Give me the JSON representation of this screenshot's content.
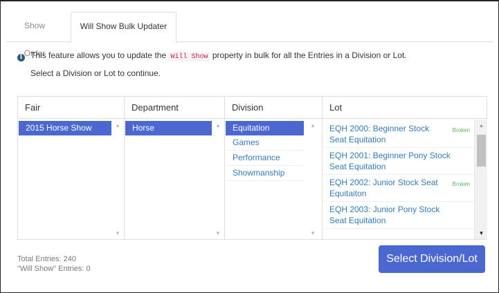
{
  "tabs": [
    {
      "label": "Show Order",
      "active": false
    },
    {
      "label": "Will Show Bulk Updater",
      "active": true
    }
  ],
  "info": {
    "prefix": "This feature allows you to update the",
    "code": "Will Show",
    "suffix": "property in bulk for all the Entries in a Division or Lot.",
    "instruction": "Select a Division or Lot to continue."
  },
  "columns": {
    "fair": {
      "header": "Fair",
      "items": [
        "2015 Horse Show"
      ],
      "selected": 0
    },
    "department": {
      "header": "Department",
      "items": [
        "Horse"
      ],
      "selected": 0
    },
    "division": {
      "header": "Division",
      "items": [
        "Equitation",
        "Games",
        "Performance",
        "Showmanship"
      ],
      "selected": 0
    },
    "lot": {
      "header": "Lot",
      "items": [
        {
          "label": "EQH 2000: Beginner Stock Seat Equitation",
          "badge": "Broken"
        },
        {
          "label": "EQH 2001: Beginner Pony Stock Seat Equitation",
          "badge": ""
        },
        {
          "label": "EQH 2002: Junior Stock Seat Equitaiton",
          "badge": "Broken"
        },
        {
          "label": "EQH 2003: Junior Pony Stock Seat Equitation",
          "badge": ""
        }
      ]
    }
  },
  "footer": {
    "total_entries": "Total Entries: 240",
    "will_show_entries": "\"Will Show\" Entries: 0",
    "button_label": "Select Division/Lot"
  },
  "colors": {
    "accent": "#4a68cf",
    "link": "#337ab7",
    "badge": "#5cb85c",
    "code": "#c7254e"
  },
  "icons": {
    "info": "info-circle-icon",
    "scroll_up": "caret-up-icon",
    "scroll_down": "caret-down-icon"
  }
}
